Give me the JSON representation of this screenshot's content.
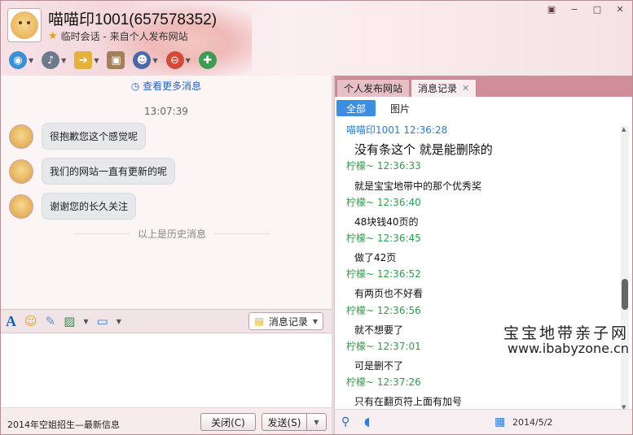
{
  "window": {
    "title": "喵喵印1001(657578352)",
    "subtitle": "临时会话 - 来自个人发布网站",
    "controls": [
      "▣",
      "−",
      "□",
      "✕"
    ]
  },
  "colors": {
    "accent": "#3d8de0",
    "tab_bar": "#cf8e98",
    "header": "#f3d7dd",
    "them_name": "#2a7bd3",
    "me_name": "#2e9a4c"
  },
  "toolbar": {
    "icons": [
      "video-call-icon",
      "voice-call-icon",
      "send-file-icon",
      "remote-desktop-icon",
      "contact-avatar-icon",
      "block-user-icon",
      "add-friend-icon"
    ]
  },
  "chat": {
    "more_link": "查看更多消息",
    "timestamp": "13:07:39",
    "messages": [
      "很抱歉您这个感觉呢",
      "我们的网站一直有更新的呢",
      "谢谢您的长久关注"
    ],
    "history_divider": "以上是历史消息"
  },
  "format_bar": {
    "history_button": "消息记录"
  },
  "bottom": {
    "news": "2014年空姐招生—最新信息",
    "close_button": "关闭(C)",
    "send_button": "发送(S)"
  },
  "right": {
    "tabs": [
      "个人发布网站",
      "消息记录"
    ],
    "filters": [
      "全部",
      "图片"
    ],
    "log": [
      {
        "sender": "喵喵印1001 12:36:28",
        "text": "没有条这个 就是能删除的",
        "who": "them"
      },
      {
        "sender": "柠檬~ 12:36:33",
        "text": "就是宝宝地带中的那个优秀奖",
        "who": "me"
      },
      {
        "sender": "柠檬~ 12:36:40",
        "text": "48块钱40页的",
        "who": "me"
      },
      {
        "sender": "柠檬~ 12:36:45",
        "text": "做了42页",
        "who": "me"
      },
      {
        "sender": "柠檬~ 12:36:52",
        "text": "有两页也不好看",
        "who": "me"
      },
      {
        "sender": "柠檬~ 12:36:56",
        "text": "就不想要了",
        "who": "me"
      },
      {
        "sender": "柠檬~ 12:37:01",
        "text": "可是删不了",
        "who": "me"
      },
      {
        "sender": "柠檬~ 12:37:26",
        "text": "只有在翻页符上面有加号",
        "who": "me"
      }
    ],
    "date_partial": "2014/5/2"
  },
  "watermark": {
    "line1": "宝宝地带亲子网",
    "line2": "www.ibabyzone.cn"
  }
}
